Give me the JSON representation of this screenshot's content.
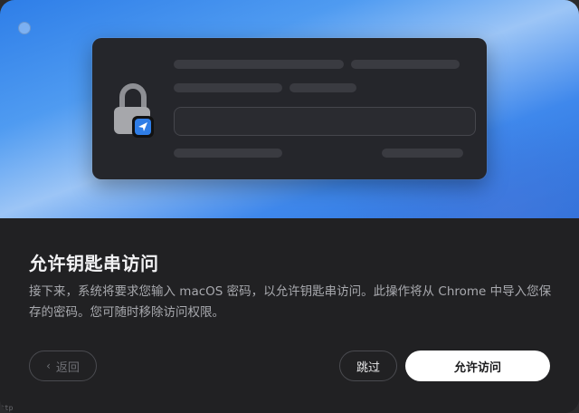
{
  "dialog": {
    "title": "允许钥匙串访问",
    "description": "接下来，系统将要求您输入 macOS 密码，以允许钥匙串访问。此操作将从 Chrome 中导入您保存的密码。您可随时移除访问权限。",
    "buttons": {
      "back_label": "返回",
      "skip_label": "跳过",
      "allow_label": "允许访问"
    }
  },
  "icons": {
    "back": "chevron-left-icon",
    "lock": "lock-icon",
    "badge": "send-icon"
  },
  "colors": {
    "hero_blue": "#2e7ee8",
    "dialog_bg": "#212123",
    "primary_button": "#ffffff",
    "badge_blue": "#2f7de6"
  },
  "corner_fragment": "ttp"
}
